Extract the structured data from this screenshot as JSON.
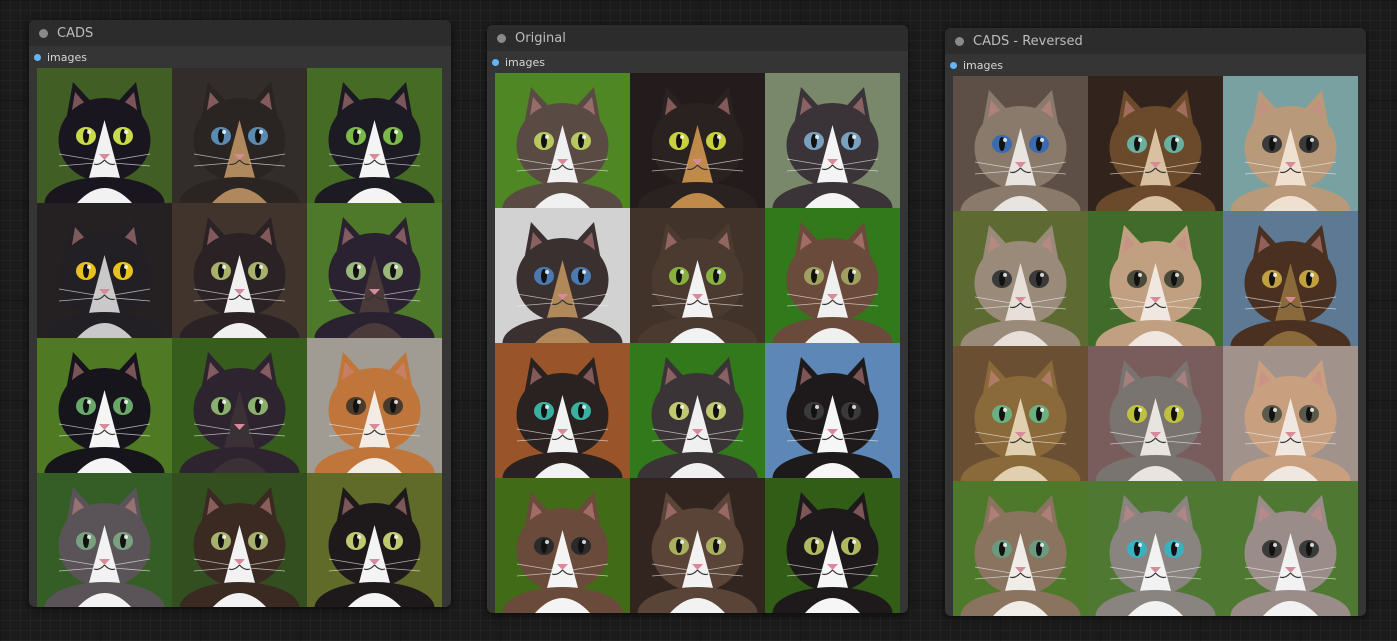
{
  "nodes": [
    {
      "id": "cads",
      "title": "CADS",
      "output_label": "images",
      "cells": [
        {
          "bg": "#4a6b2a",
          "fur": "#1a1620",
          "accent": "#f2f2f2",
          "eye": "#c8d94a"
        },
        {
          "bg": "#3a3432",
          "fur": "#2a2422",
          "accent": "#b0885e",
          "eye": "#5a8ab0"
        },
        {
          "bg": "#4f7a2a",
          "fur": "#1c1a22",
          "accent": "#f4f4f4",
          "eye": "#7ab84a"
        },
        {
          "bg": "#2b2628",
          "fur": "#222024",
          "accent": "#c9c9c9",
          "eye": "#e8c020"
        },
        {
          "bg": "#4a3c34",
          "fur": "#2a2224",
          "accent": "#f0f0f0",
          "eye": "#a8b06a"
        },
        {
          "bg": "#5a8a30",
          "fur": "#2a2230",
          "accent": "#4a3a3a",
          "eye": "#9ab87a"
        },
        {
          "bg": "#5c8a2a",
          "fur": "#17151c",
          "accent": "#f5f5f5",
          "eye": "#6aa86a"
        },
        {
          "bg": "#3f6a22",
          "fur": "#2e2430",
          "accent": "#3a3036",
          "eye": "#8ab070"
        },
        {
          "bg": "#b8b2a8",
          "fur": "#c0753a",
          "accent": "#f2ece4",
          "eye": "#4a3a2a"
        },
        {
          "bg": "#3d6c2c",
          "fur": "#5a5458",
          "accent": "#f2f2f2",
          "eye": "#7aa080"
        },
        {
          "bg": "#3c5a24",
          "fur": "#3a2a22",
          "accent": "#f2f2f2",
          "eye": "#a8b070"
        },
        {
          "bg": "#6e7a30",
          "fur": "#1e1a1c",
          "accent": "#f4f4f4",
          "eye": "#c0c870"
        }
      ]
    },
    {
      "id": "orig",
      "title": "Original",
      "output_label": "images",
      "cells": [
        {
          "bg": "#5a9a2a",
          "fur": "#5a4a44",
          "accent": "#f0f0f0",
          "eye": "#b8c860"
        },
        {
          "bg": "#2a2020",
          "fur": "#2a2220",
          "accent": "#c08a4a",
          "eye": "#c8d040"
        },
        {
          "bg": "#8a9a7a",
          "fur": "#3a3438",
          "accent": "#f4f4f4",
          "eye": "#7aa0c0"
        },
        {
          "bg": "#f0f0f0",
          "fur": "#3a3030",
          "accent": "#b0885a",
          "eye": "#4a7ab0"
        },
        {
          "bg": "#4a3a30",
          "fur": "#4a3a30",
          "accent": "#f2f2f2",
          "eye": "#8ab040"
        },
        {
          "bg": "#3a8a20",
          "fur": "#6a4a3a",
          "accent": "#f0f0f0",
          "eye": "#a0a060"
        },
        {
          "bg": "#b06030",
          "fur": "#2a2220",
          "accent": "#f2f2f2",
          "eye": "#3ab0a0"
        },
        {
          "bg": "#3a8a20",
          "fur": "#3a3436",
          "accent": "#f0f0f0",
          "eye": "#c0c870"
        },
        {
          "bg": "#6a9ad0",
          "fur": "#1e1a1c",
          "accent": "#f6f6f6",
          "eye": "#3a3a3a"
        },
        {
          "bg": "#4a7a1a",
          "fur": "#6a4a3a",
          "accent": "#f4f4f4",
          "eye": "#2a2a2a"
        },
        {
          "bg": "#3a2a24",
          "fur": "#5a4438",
          "accent": "#f2f2f2",
          "eye": "#a8b060"
        },
        {
          "bg": "#3a6a1a",
          "fur": "#1e1a1c",
          "accent": "#f6f6f6",
          "eye": "#b0b860"
        }
      ]
    },
    {
      "id": "rev",
      "title": "CADS - Reversed",
      "output_label": "images",
      "cells": [
        {
          "bg": "#6a5a50",
          "fur": "#8a7a6c",
          "accent": "#e8e4e0",
          "eye": "#3a6ab0"
        },
        {
          "bg": "#3a2a20",
          "fur": "#6a4a2a",
          "accent": "#d8c0a0",
          "eye": "#6ab0a0"
        },
        {
          "bg": "#8ab8b8",
          "fur": "#b89a7a",
          "accent": "#f0e0d0",
          "eye": "#3a3a3a"
        },
        {
          "bg": "#6a7a3a",
          "fur": "#9a8a7a",
          "accent": "#e8e0d8",
          "eye": "#3a3a3a"
        },
        {
          "bg": "#4a7a30",
          "fur": "#c0a080",
          "accent": "#f0e8e0",
          "eye": "#4a4a3a"
        },
        {
          "bg": "#6a8aa8",
          "fur": "#4a3020",
          "accent": "#8a6a3a",
          "eye": "#c0a040"
        },
        {
          "bg": "#7a5a3a",
          "fur": "#8a6a3a",
          "accent": "#e0d0b0",
          "eye": "#6ab080"
        },
        {
          "bg": "#8a6a6a",
          "fur": "#7a7470",
          "accent": "#e8e4e0",
          "eye": "#c0c040"
        },
        {
          "bg": "#b8a8a0",
          "fur": "#c8a080",
          "accent": "#f0e8e0",
          "eye": "#5a5a4a"
        },
        {
          "bg": "#5a8a30",
          "fur": "#8a7460",
          "accent": "#f0ece8",
          "eye": "#6a9a80"
        },
        {
          "bg": "#5a8a3a",
          "fur": "#8a8480",
          "accent": "#f2f2f2",
          "eye": "#3ab0c0"
        },
        {
          "bg": "#5a8a3a",
          "fur": "#9a8c88",
          "accent": "#f2f2f2",
          "eye": "#3a3a3a"
        }
      ]
    }
  ]
}
